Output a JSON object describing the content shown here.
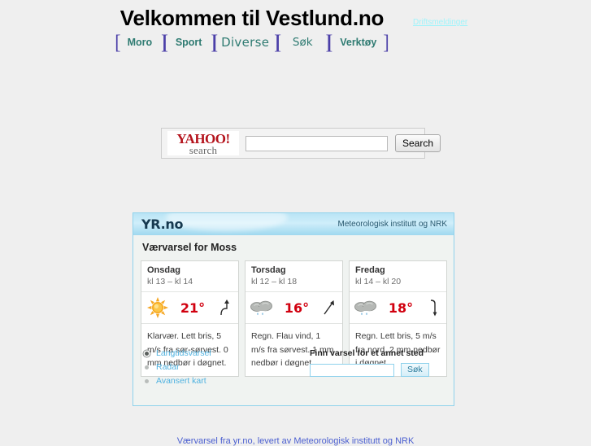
{
  "header": {
    "site_title": "Velkommen til Vestlund.no",
    "status_link": "Driftsmeldinger"
  },
  "nav": {
    "bracket_left": "[",
    "bracket_right": "]",
    "bracket_inner": "][",
    "items": [
      {
        "label": "Moro"
      },
      {
        "label": "Sport"
      },
      {
        "label": "Diverse"
      },
      {
        "label": "Søk"
      },
      {
        "label": "Verktøy"
      }
    ]
  },
  "search_widget": {
    "logo_word": "YAHOO",
    "logo_bang": "!",
    "logo_sub": "search",
    "input_value": "",
    "input_placeholder": "",
    "submit_label": "Search"
  },
  "weather": {
    "logo": "YR.no",
    "credit": "Meteorologisk institutt og NRK",
    "title": "Værvarsel for Moss",
    "forecasts": [
      {
        "day": "Onsdag",
        "time": "kl 13 – kl 14",
        "icon": "sun-icon",
        "temperature": "21°",
        "wind_icon": "wind-arrow-hook-icon",
        "description": "Klarvær. Lett bris, 5 m/s fra sør-sørvest. 0 mm nedbør i døgnet."
      },
      {
        "day": "Torsdag",
        "time": "kl 12 – kl 18",
        "icon": "rain-cloud-icon",
        "temperature": "16°",
        "wind_icon": "wind-arrow-straight-icon",
        "description": "Regn. Flau vind, 1 m/s fra sørvest. 1 mm nedbør i døgnet."
      },
      {
        "day": "Fredag",
        "time": "kl 14 – kl 20",
        "icon": "rain-cloud-icon",
        "temperature": "18°",
        "wind_icon": "wind-arrow-bent-icon",
        "description": "Regn. Lett bris, 5 m/s fra nord. 2 mm nedbør i døgnet."
      }
    ],
    "links": [
      {
        "label": "Langtidsvarsel"
      },
      {
        "label": "Radar"
      },
      {
        "label": "Avansert kart"
      }
    ],
    "find": {
      "label": "Finn varsel for et annet sted",
      "input_value": "",
      "input_placeholder": "",
      "button_label": "Søk"
    }
  },
  "footer": {
    "note": "Værvarsel fra yr.no, levert av Meteorologisk institutt og NRK"
  },
  "colors": {
    "page_background": "#efefef",
    "title_text": "#000000",
    "nav_bracket": "#4b3fa8",
    "nav_item": "#2f7b72",
    "status_link": "#9ff4fb",
    "yahoo_red": "#b4121b",
    "yr_border": "#8fd2ec",
    "temperature": "#d1000f",
    "link_blue": "#4fb2e0",
    "footer_link": "#4b5fd0"
  }
}
